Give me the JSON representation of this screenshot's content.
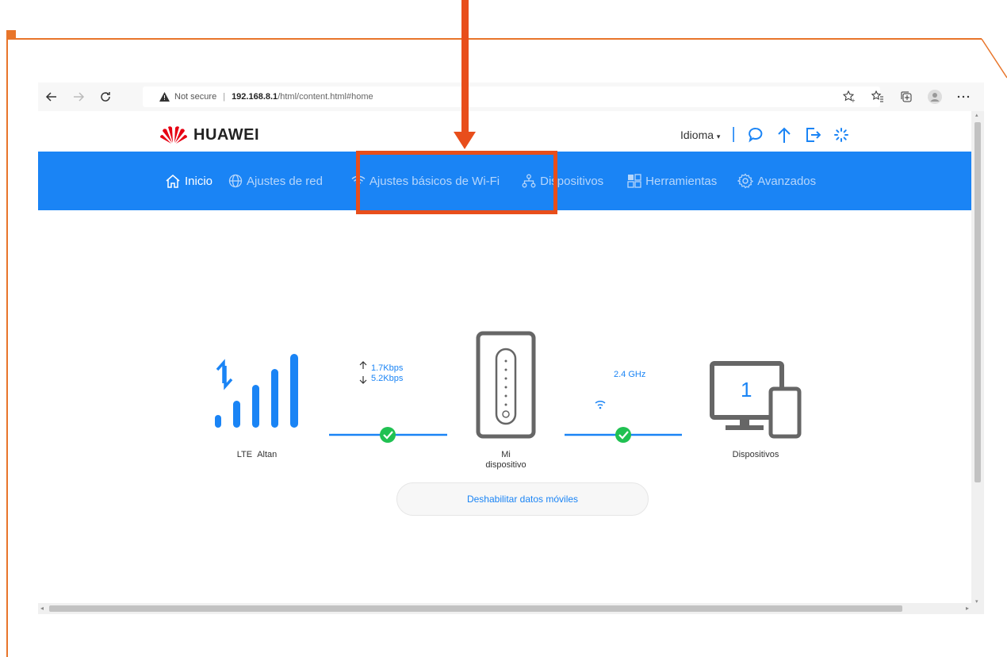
{
  "browser": {
    "security_label": "Not secure",
    "url_host": "192.168.8.1",
    "url_path": "/html/content.html#home"
  },
  "header": {
    "brand": "HUAWEI",
    "language_label": "Idioma",
    "brand_color": "#e60012"
  },
  "nav": {
    "accent": "#1a84f5",
    "items": [
      {
        "label": "Inicio",
        "icon": "home-icon",
        "active": true
      },
      {
        "label": "Ajustes de red",
        "icon": "globe-icon",
        "active": false
      },
      {
        "label": "Ajustes básicos de Wi-Fi",
        "icon": "wifi-icon",
        "active": false
      },
      {
        "label": "Dispositivos",
        "icon": "network-icon",
        "active": false
      },
      {
        "label": "Herramientas",
        "icon": "grid-icon",
        "active": false
      },
      {
        "label": "Avanzados",
        "icon": "gear-icon",
        "active": false
      }
    ]
  },
  "status": {
    "network_type": "LTE",
    "operator": "Altan",
    "upload_speed": "1.7Kbps",
    "download_speed": "5.2Kbps",
    "device_label_line1": "Mi",
    "device_label_line2": "dispositivo",
    "wifi_band": "2.4 GHz",
    "connected_count": "1",
    "devices_label": "Dispositivos"
  },
  "actions": {
    "disable_mobile_data": "Deshabilitar datos móviles"
  },
  "annotation": {
    "highlight_color": "#e84e1b"
  }
}
